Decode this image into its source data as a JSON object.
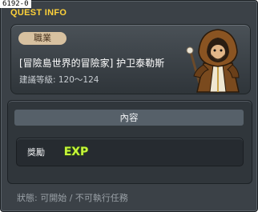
{
  "overlay_code": "6192-0",
  "window": {
    "title": "QUEST INFO"
  },
  "quest": {
    "job_badge": "職業",
    "name": "[冒險島世界的冒險家] 护卫泰勒斯",
    "level_text": "建議等級: 120～124",
    "npc_icon": "hooded-robed-npc-icon"
  },
  "content": {
    "header": "內容",
    "reward_label": "獎勵",
    "reward_icon": "exp-icon",
    "reward_icon_text": "EXP"
  },
  "status": {
    "text": "狀態: 可開始 / 不可執行任務"
  },
  "colors": {
    "title": "#ffd23a",
    "window_bg": "#3b4147",
    "job_badge_bg": "#d7c1a0",
    "exp_fill": "#c8f53a"
  }
}
